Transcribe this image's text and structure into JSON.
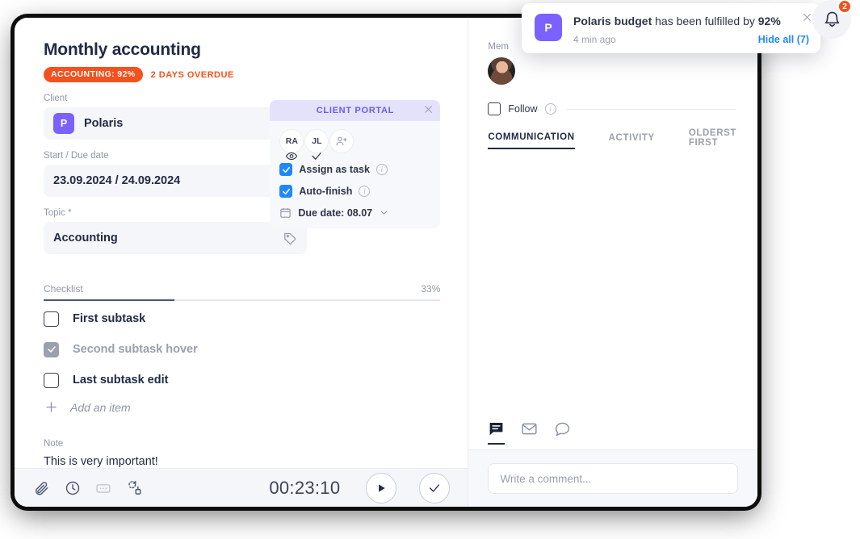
{
  "task": {
    "title": "Monthly accounting",
    "badge": "ACCOUNTING: 92%",
    "overdue": "2 DAYS OVERDUE",
    "client_label": "Client",
    "client_initial": "P",
    "client_name": "Polaris",
    "date_label": "Start / Due date",
    "date_value": "23.09.2024 / 24.09.2024",
    "topic_label": "Topic *",
    "topic_value": "Accounting",
    "note_label": "Note",
    "note_value": "This is very important!"
  },
  "portal": {
    "header": "CLIENT PORTAL",
    "avatars": [
      {
        "initials": "RA",
        "marker": "eye"
      },
      {
        "initials": "JL",
        "marker": "check"
      }
    ],
    "add_label": "add-person",
    "assign_label": "Assign as task",
    "autofinish_label": "Auto-finish",
    "due_label": "Due date: 08.07"
  },
  "checklist": {
    "label": "Checklist",
    "percent": "33%",
    "progress": 33,
    "items": [
      {
        "text": "First subtask",
        "done": false
      },
      {
        "text": "Second subtask hover",
        "done": true
      },
      {
        "text": "Last subtask edit",
        "done": false
      }
    ],
    "add_item": "Add an item"
  },
  "footer": {
    "icons": [
      "attachment-icon",
      "time-icon",
      "comment-icon",
      "subtask-icon"
    ],
    "timer": "00:23:10",
    "play_label": "start-timer",
    "done_label": "complete-task"
  },
  "right": {
    "members_label": "Mem",
    "follow_label": "Follow",
    "tabs": [
      {
        "label": "COMMUNICATION",
        "active": true
      },
      {
        "label": "ACTIVITY",
        "active": false
      }
    ],
    "sort_label": "OLDERST FIRST",
    "comment_tabs": [
      "note-icon",
      "email-icon",
      "chat-icon"
    ],
    "comment_placeholder": "Write a comment..."
  },
  "notification": {
    "avatar_initial": "P",
    "bold_text": "Polaris budget",
    "text_mid": " has been fulfilled by ",
    "bold_percent": "92%",
    "time": "4 min ago",
    "hide_all": "Hide all (7)",
    "bell_count": "2"
  },
  "colors": {
    "accent_orange": "#f4511e",
    "brand_purple": "#7b61ff",
    "link_blue": "#1e88ff",
    "portal_purple": "#6c5ce7"
  }
}
